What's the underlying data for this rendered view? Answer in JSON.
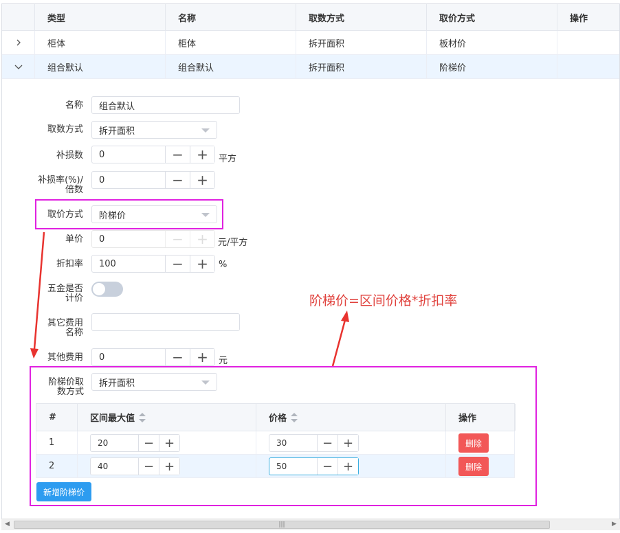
{
  "table": {
    "headers": [
      "类型",
      "名称",
      "取数方式",
      "取价方式",
      "操作"
    ],
    "rows": [
      {
        "type": "柜体",
        "name": "柜体",
        "quantity_method": "拆开面积",
        "price_method": "板材价",
        "op": ""
      },
      {
        "type": "组合默认",
        "name": "组合默认",
        "quantity_method": "拆开面积",
        "price_method": "阶梯价",
        "op": ""
      }
    ]
  },
  "form": {
    "name": {
      "label": "名称",
      "value": "组合默认"
    },
    "quantity_method": {
      "label": "取数方式",
      "value": "拆开面积"
    },
    "loss": {
      "label": "补损数",
      "value": "0",
      "unit": "平方"
    },
    "loss_rate": {
      "label_line1": "补损率(%)/",
      "label_line2": "倍数",
      "value": "0"
    },
    "price_method": {
      "label": "取价方式",
      "value": "阶梯价"
    },
    "unit_price": {
      "label": "单价",
      "value": "0",
      "unit": "元/平方"
    },
    "discount": {
      "label": "折扣率",
      "value": "100",
      "unit": "%"
    },
    "hardware_priced": {
      "label_line1": "五金是否",
      "label_line2": "计价",
      "on": false
    },
    "other_fee_name": {
      "label_line1": "其它费用",
      "label_line2": "名称",
      "value": ""
    },
    "other_fee": {
      "label": "其他费用",
      "value": "0",
      "unit": "元"
    },
    "tier_quantity_method": {
      "label_line1": "阶梯价取",
      "label_line2": "数方式",
      "value": "拆开面积"
    }
  },
  "annotation": "阶梯价=区间价格*折扣率",
  "tier_table": {
    "headers": {
      "index": "#",
      "max": "区间最大值",
      "price": "价格",
      "op": "操作"
    },
    "rows": [
      {
        "index": "1",
        "max": "20",
        "price": "30",
        "delete_label": "删除"
      },
      {
        "index": "2",
        "max": "40",
        "price": "50",
        "delete_label": "删除"
      }
    ],
    "add_label": "新增阶梯价"
  },
  "colors": {
    "highlight_box": "#e021e0",
    "annotation": "#e0413c",
    "primary": "#2d9cf0",
    "danger": "#f25757"
  }
}
